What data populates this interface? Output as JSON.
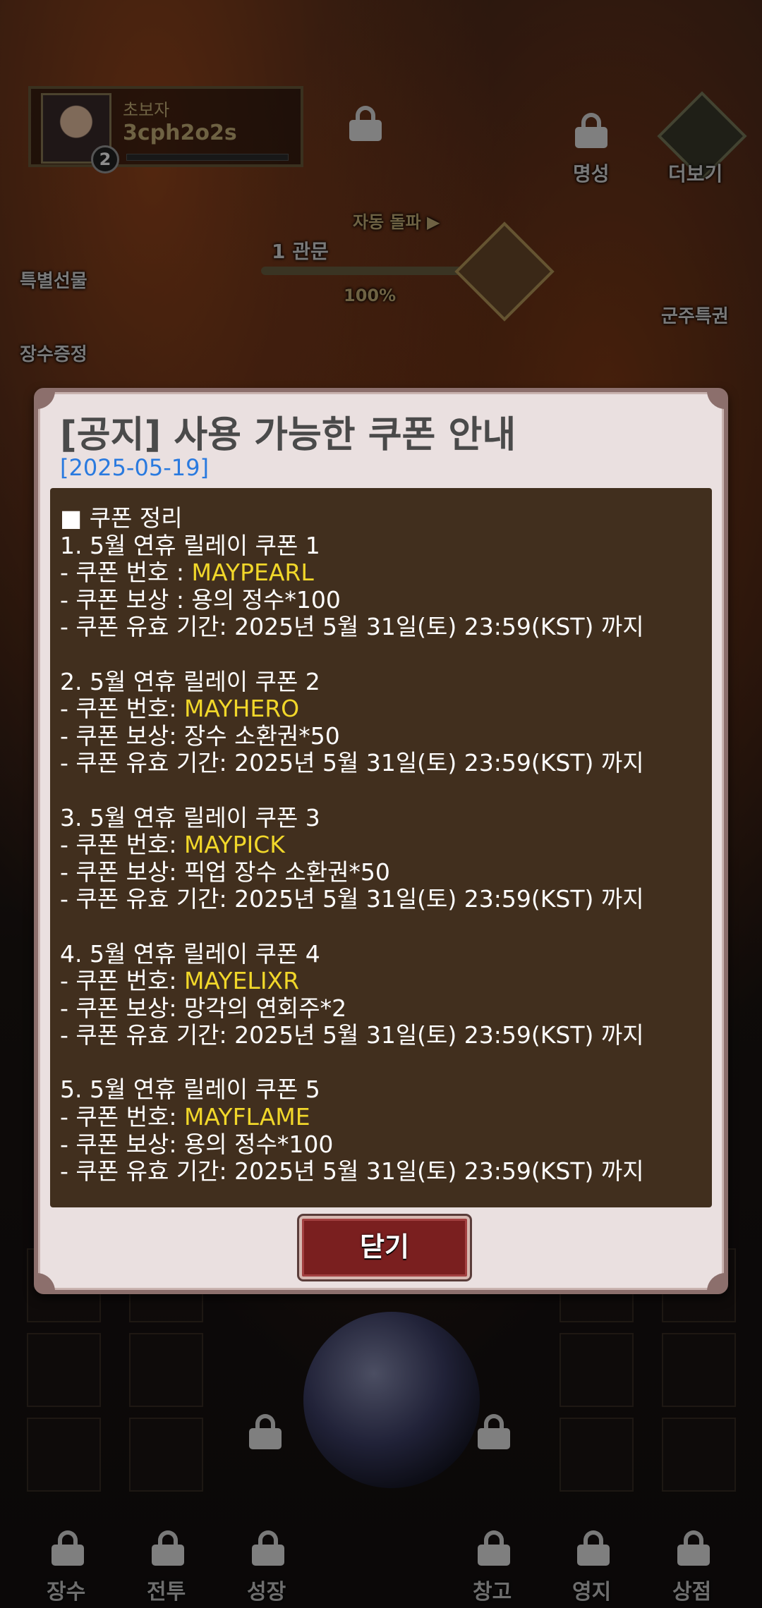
{
  "hud": {
    "rank": "초보자",
    "player_name": "3cph2o2s",
    "level": "2",
    "reputation_label": "명성",
    "more_label": "더보기",
    "auto_break_label": "자동 돌파 ▶",
    "stage_label": "1 관문",
    "stage_progress": "100%",
    "special_gift_label": "특별선물",
    "general_proof_label": "장수증정",
    "lord_privilege_label": "군주특권"
  },
  "notice": {
    "title": "[공지] 사용 가능한 쿠폰 안내",
    "date": "[2025-05-19]",
    "heading": "■ 쿠폰 정리",
    "coupons": [
      {
        "title": "1. 5월 연휴 릴레이 쿠폰 1",
        "code_prefix": "- 쿠폰 번호 : ",
        "code": "MAYPEARL",
        "reward": "- 쿠폰 보상 : 용의 정수*100",
        "expiry": "- 쿠폰 유효 기간: 2025년 5월 31일(토) 23:59(KST) 까지"
      },
      {
        "title": "2. 5월 연휴 릴레이 쿠폰 2",
        "code_prefix": "- 쿠폰 번호: ",
        "code": "MAYHERO",
        "reward": "- 쿠폰 보상: 장수 소환권*50",
        "expiry": "- 쿠폰 유효 기간: 2025년 5월 31일(토) 23:59(KST) 까지"
      },
      {
        "title": "3. 5월 연휴 릴레이 쿠폰 3",
        "code_prefix": "- 쿠폰 번호: ",
        "code": "MAYPICK",
        "reward": "- 쿠폰 보상: 픽업 장수 소환권*50",
        "expiry": "- 쿠폰 유효 기간: 2025년 5월 31일(토) 23:59(KST) 까지"
      },
      {
        "title": "4. 5월 연휴 릴레이 쿠폰 4",
        "code_prefix": "- 쿠폰 번호: ",
        "code": "MAYELIXR",
        "reward": "- 쿠폰 보상: 망각의 연회주*2",
        "expiry": "- 쿠폰 유효 기간: 2025년 5월 31일(토) 23:59(KST) 까지"
      },
      {
        "title": "5. 5월 연휴 릴레이 쿠폰 5",
        "code_prefix": "- 쿠폰 번호: ",
        "code": "MAYFLAME",
        "reward": "- 쿠폰 보상: 용의 정수*100",
        "expiry": "- 쿠폰 유효 기간: 2025년 5월 31일(토) 23:59(KST) 까지"
      }
    ],
    "close_label": "닫기"
  },
  "bottom_nav": {
    "general": "장수",
    "battle": "전투",
    "growth": "성장",
    "storage": "창고",
    "territory": "영지",
    "shop": "상점"
  },
  "colors": {
    "modal_bg": "#eae0e0",
    "content_bg": "#412f1e",
    "code_highlight": "#f1d72a",
    "date_blue": "#2a7adf",
    "close_button": "#7a1f1f"
  }
}
